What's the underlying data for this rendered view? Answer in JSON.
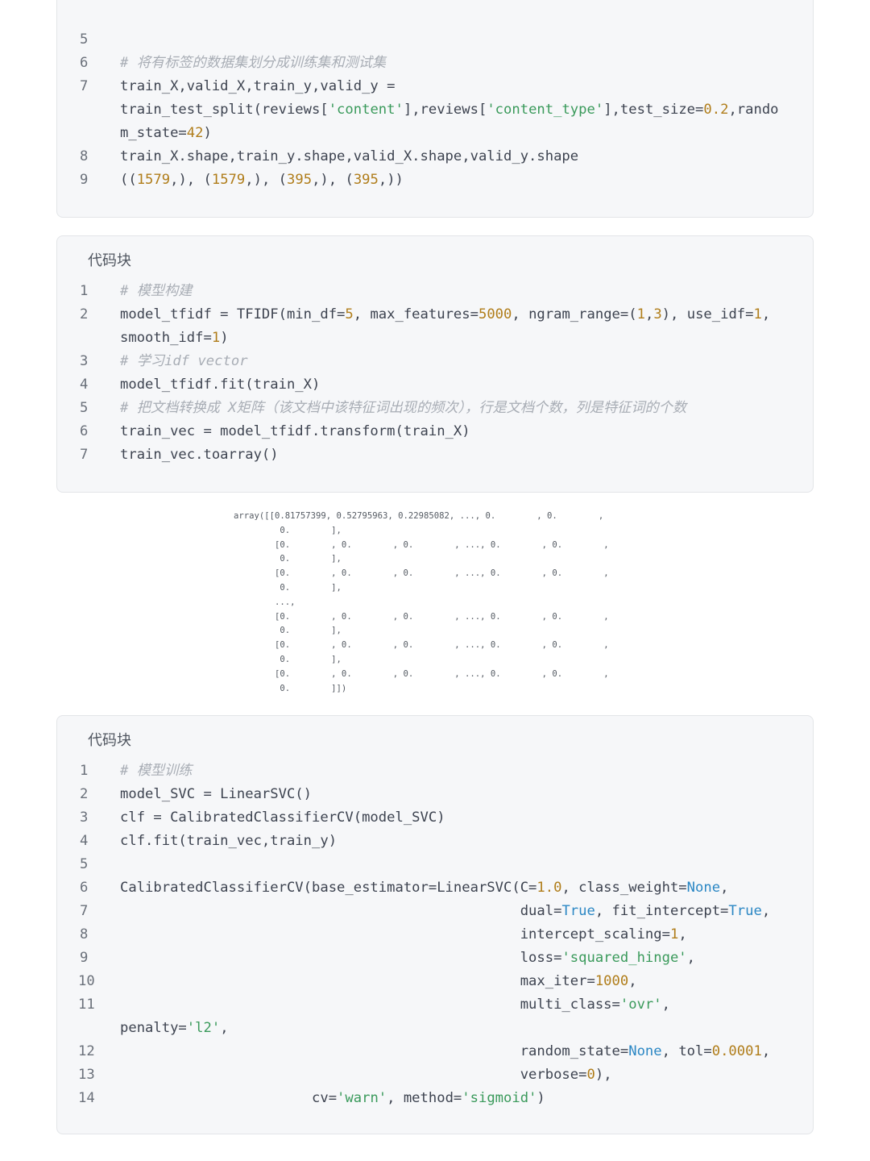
{
  "blocks": [
    {
      "title": "",
      "lines": [
        {
          "n": "5",
          "tokens": []
        },
        {
          "n": "6",
          "tokens": [
            {
              "t": "# 将有标签的数据集划分成训练集和测试集",
              "c": "cmt"
            }
          ]
        },
        {
          "n": "7",
          "tokens": [
            {
              "t": "train_X,valid_X,train_y,valid_y =",
              "c": ""
            }
          ]
        },
        {
          "n": "",
          "tokens": [
            {
              "t": "train_test_split(reviews[",
              "c": ""
            },
            {
              "t": "'content'",
              "c": "str"
            },
            {
              "t": "],reviews[",
              "c": ""
            },
            {
              "t": "'content_type'",
              "c": "str"
            },
            {
              "t": "],test_size=",
              "c": ""
            },
            {
              "t": "0.2",
              "c": "num"
            },
            {
              "t": ",rando",
              "c": ""
            }
          ]
        },
        {
          "n": "",
          "tokens": [
            {
              "t": "m_state=",
              "c": ""
            },
            {
              "t": "42",
              "c": "num"
            },
            {
              "t": ")",
              "c": ""
            }
          ]
        },
        {
          "n": "8",
          "tokens": [
            {
              "t": "train_X.shape,train_y.shape,valid_X.shape,valid_y.shape",
              "c": ""
            }
          ]
        },
        {
          "n": "9",
          "tokens": [
            {
              "t": "((",
              "c": ""
            },
            {
              "t": "1579",
              "c": "num"
            },
            {
              "t": ",), (",
              "c": ""
            },
            {
              "t": "1579",
              "c": "num"
            },
            {
              "t": ",), (",
              "c": ""
            },
            {
              "t": "395",
              "c": "num"
            },
            {
              "t": ",), (",
              "c": ""
            },
            {
              "t": "395",
              "c": "num"
            },
            {
              "t": ",))",
              "c": ""
            }
          ]
        }
      ]
    },
    {
      "title": "代码块",
      "lines": [
        {
          "n": "1",
          "tokens": [
            {
              "t": "# 模型构建",
              "c": "cmt"
            }
          ]
        },
        {
          "n": "2",
          "tokens": [
            {
              "t": "model_tfidf = TFIDF(min_df=",
              "c": ""
            },
            {
              "t": "5",
              "c": "num"
            },
            {
              "t": ", max_features=",
              "c": ""
            },
            {
              "t": "5000",
              "c": "num"
            },
            {
              "t": ", ngram_range=(",
              "c": ""
            },
            {
              "t": "1",
              "c": "num"
            },
            {
              "t": ",",
              "c": ""
            },
            {
              "t": "3",
              "c": "num"
            },
            {
              "t": "), use_idf=",
              "c": ""
            },
            {
              "t": "1",
              "c": "num"
            },
            {
              "t": ",",
              "c": ""
            }
          ]
        },
        {
          "n": "",
          "tokens": [
            {
              "t": "smooth_idf=",
              "c": ""
            },
            {
              "t": "1",
              "c": "num"
            },
            {
              "t": ")",
              "c": ""
            }
          ]
        },
        {
          "n": "3",
          "tokens": [
            {
              "t": "# 学习idf vector",
              "c": "cmt"
            }
          ]
        },
        {
          "n": "4",
          "tokens": [
            {
              "t": "model_tfidf.fit(train_X)",
              "c": ""
            }
          ]
        },
        {
          "n": "5",
          "tokens": [
            {
              "t": "# 把文档转换成 X矩阵（该文档中该特征词出现的频次），行是文档个数，列是特征词的个数",
              "c": "cmt"
            }
          ]
        },
        {
          "n": "6",
          "tokens": [
            {
              "t": "train_vec = model_tfidf.transform(train_X)",
              "c": ""
            }
          ]
        },
        {
          "n": "7",
          "tokens": [
            {
              "t": "train_vec.toarray()",
              "c": ""
            }
          ]
        }
      ]
    },
    {
      "title": "代码块",
      "lines": [
        {
          "n": "1",
          "tokens": [
            {
              "t": "# 模型训练",
              "c": "cmt"
            }
          ]
        },
        {
          "n": "2",
          "tokens": [
            {
              "t": "model_SVC = LinearSVC()",
              "c": ""
            }
          ]
        },
        {
          "n": "3",
          "tokens": [
            {
              "t": "clf = CalibratedClassifierCV(model_SVC)",
              "c": ""
            }
          ]
        },
        {
          "n": "4",
          "tokens": [
            {
              "t": "clf.fit(train_vec,train_y)",
              "c": ""
            }
          ]
        },
        {
          "n": "5",
          "tokens": []
        },
        {
          "n": "6",
          "tokens": [
            {
              "t": "CalibratedClassifierCV(base_estimator=LinearSVC(C=",
              "c": ""
            },
            {
              "t": "1.0",
              "c": "num"
            },
            {
              "t": ", class_weight=",
              "c": ""
            },
            {
              "t": "None",
              "c": "kw"
            },
            {
              "t": ",",
              "c": ""
            }
          ]
        },
        {
          "n": "7",
          "tokens": [
            {
              "t": "                                                dual=",
              "c": ""
            },
            {
              "t": "True",
              "c": "kw"
            },
            {
              "t": ", fit_intercept=",
              "c": ""
            },
            {
              "t": "True",
              "c": "kw"
            },
            {
              "t": ",",
              "c": ""
            }
          ]
        },
        {
          "n": "8",
          "tokens": [
            {
              "t": "                                                intercept_scaling=",
              "c": ""
            },
            {
              "t": "1",
              "c": "num"
            },
            {
              "t": ",",
              "c": ""
            }
          ]
        },
        {
          "n": "9",
          "tokens": [
            {
              "t": "                                                loss=",
              "c": ""
            },
            {
              "t": "'squared_hinge'",
              "c": "str"
            },
            {
              "t": ",",
              "c": ""
            }
          ]
        },
        {
          "n": "10",
          "tokens": [
            {
              "t": "                                                max_iter=",
              "c": ""
            },
            {
              "t": "1000",
              "c": "num"
            },
            {
              "t": ",",
              "c": ""
            }
          ]
        },
        {
          "n": "11",
          "tokens": [
            {
              "t": "                                                multi_class=",
              "c": ""
            },
            {
              "t": "'ovr'",
              "c": "str"
            },
            {
              "t": ",",
              "c": ""
            }
          ]
        },
        {
          "n": "",
          "tokens": [
            {
              "t": "penalty=",
              "c": ""
            },
            {
              "t": "'l2'",
              "c": "str"
            },
            {
              "t": ",",
              "c": ""
            }
          ]
        },
        {
          "n": "12",
          "tokens": [
            {
              "t": "                                                random_state=",
              "c": ""
            },
            {
              "t": "None",
              "c": "kw"
            },
            {
              "t": ", tol=",
              "c": ""
            },
            {
              "t": "0.0001",
              "c": "num"
            },
            {
              "t": ",",
              "c": ""
            }
          ]
        },
        {
          "n": "13",
          "tokens": [
            {
              "t": "                                                verbose=",
              "c": ""
            },
            {
              "t": "0",
              "c": "num"
            },
            {
              "t": "),",
              "c": ""
            }
          ]
        },
        {
          "n": "14",
          "tokens": [
            {
              "t": "                       cv=",
              "c": ""
            },
            {
              "t": "'warn'",
              "c": "str"
            },
            {
              "t": ", method=",
              "c": ""
            },
            {
              "t": "'sigmoid'",
              "c": "str"
            },
            {
              "t": ")",
              "c": ""
            }
          ]
        }
      ]
    }
  ],
  "array_output": "array([[0.81757399, 0.52795963, 0.22985082, ..., 0.        , 0.        ,\n         0.        ],\n        [0.        , 0.        , 0.        , ..., 0.        , 0.        ,\n         0.        ],\n        [0.        , 0.        , 0.        , ..., 0.        , 0.        ,\n         0.        ],\n        ...,\n        [0.        , 0.        , 0.        , ..., 0.        , 0.        ,\n         0.        ],\n        [0.        , 0.        , 0.        , ..., 0.        , 0.        ,\n         0.        ],\n        [0.        , 0.        , 0.        , ..., 0.        , 0.        ,\n         0.        ]])"
}
